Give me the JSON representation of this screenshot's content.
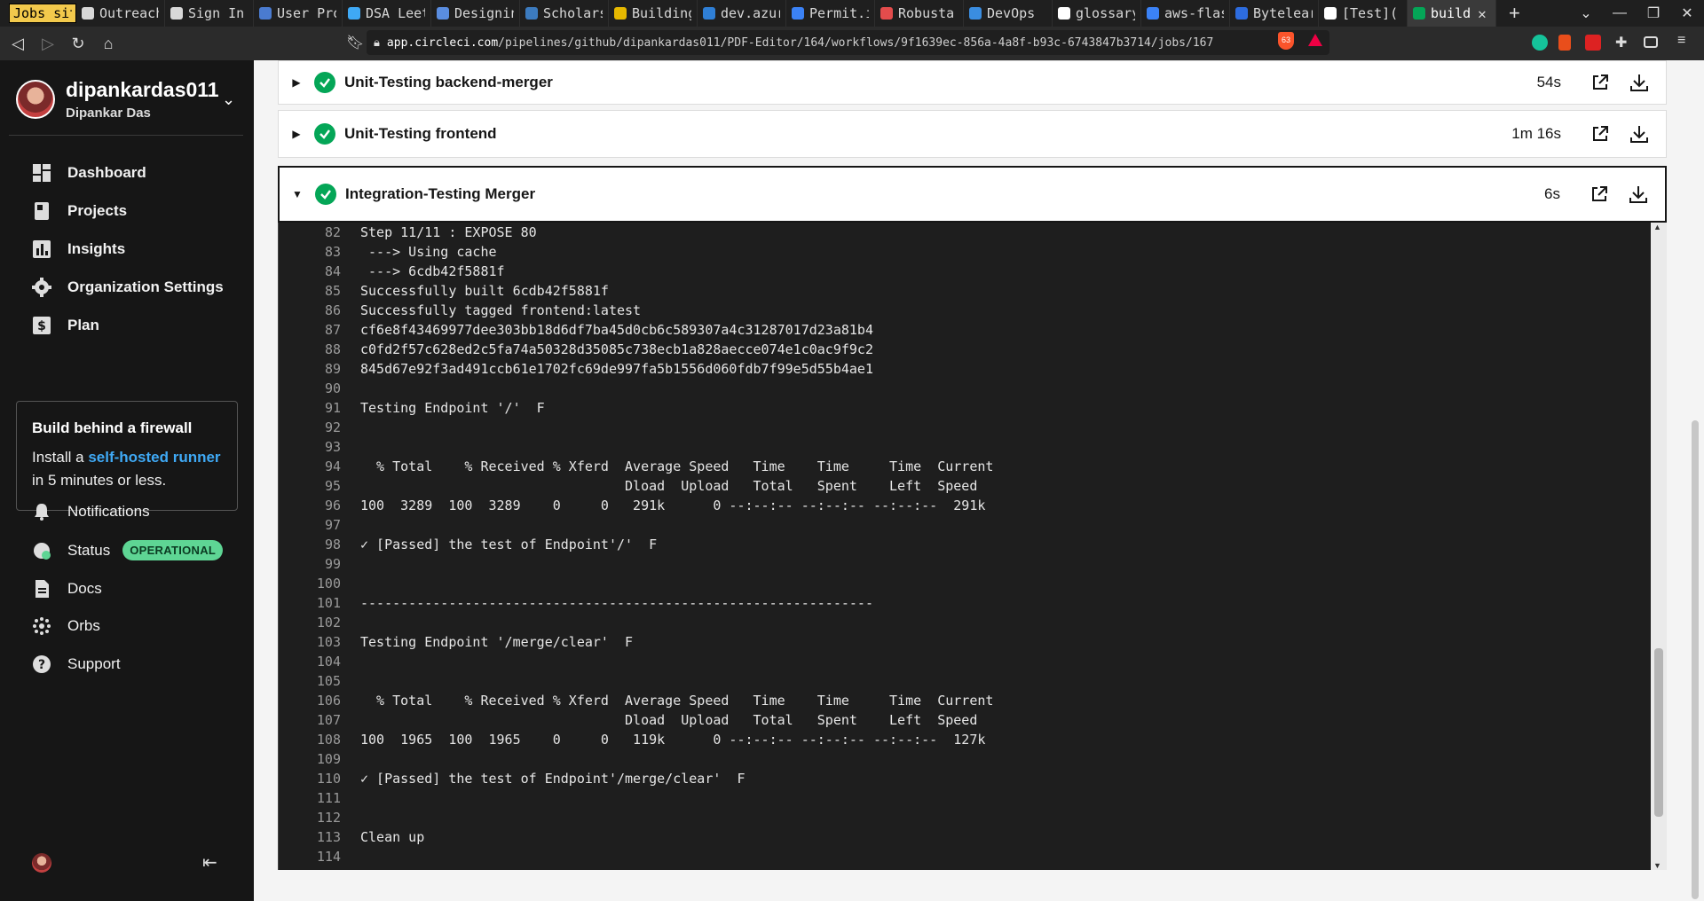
{
  "browser": {
    "tabs": [
      {
        "label": "Jobs sites",
        "color": "#f2c94c",
        "style": "highlight"
      },
      {
        "label": "Outreach",
        "color": "#d8d8d8"
      },
      {
        "label": "Sign In",
        "color": "#d8d8d8"
      },
      {
        "label": "User Pro",
        "color": "#4a7bd0"
      },
      {
        "label": "DSA Leet",
        "color": "#3fa9f5"
      },
      {
        "label": "Designin",
        "color": "#5a8de0"
      },
      {
        "label": "Scholars",
        "color": "#3c7bbf"
      },
      {
        "label": "Building",
        "color": "#e6b800"
      },
      {
        "label": "dev.azur",
        "color": "#2f7fd6"
      },
      {
        "label": "Permit.i",
        "color": "#3b82f6"
      },
      {
        "label": "Robusta",
        "color": "#e34c4c"
      },
      {
        "label": "DevOps",
        "color": "#3a8de0"
      },
      {
        "label": "glossary",
        "color": "#ffffff"
      },
      {
        "label": "aws-flas",
        "color": "#3b82f6"
      },
      {
        "label": "Bytelear",
        "color": "#2d6cdf"
      },
      {
        "label": "[Test](",
        "color": "#ffffff"
      },
      {
        "label": "build",
        "color": "#04a657",
        "style": "active"
      }
    ],
    "new_tab": "+",
    "url_host": "app.circleci.com",
    "url_path": "/pipelines/github/dipankardas011/PDF-Editor/164/workflows/9f1639ec-856a-4a8f-b93c-6743847b3714/jobs/167",
    "shield_count": "63"
  },
  "sidebar": {
    "username": "dipankardas011",
    "fullname": "Dipankar Das",
    "nav": [
      {
        "label": "Dashboard",
        "icon": "dashboard-icon"
      },
      {
        "label": "Projects",
        "icon": "projects-icon"
      },
      {
        "label": "Insights",
        "icon": "insights-icon"
      },
      {
        "label": "Organization Settings",
        "icon": "gear-icon"
      },
      {
        "label": "Plan",
        "icon": "plan-icon"
      }
    ],
    "firewall": {
      "title": "Build behind a firewall",
      "body_pre": "Install a ",
      "link": "self-hosted runner",
      "body_post": "in 5 minutes or less."
    },
    "bottom_nav": [
      {
        "label": "Notifications",
        "icon": "bell-icon"
      },
      {
        "label": "Status",
        "icon": "status-icon",
        "badge": "OPERATIONAL"
      },
      {
        "label": "Docs",
        "icon": "docs-icon"
      },
      {
        "label": "Orbs",
        "icon": "orbs-icon"
      },
      {
        "label": "Support",
        "icon": "help-icon"
      }
    ]
  },
  "jobs": [
    {
      "name": "Unit-Testing backend-merger",
      "duration": "54s",
      "expanded": false
    },
    {
      "name": "Unit-Testing frontend",
      "duration": "1m 16s",
      "expanded": false
    },
    {
      "name": "Integration-Testing Merger",
      "duration": "6s",
      "expanded": true
    }
  ],
  "console": [
    {
      "n": "82",
      "t": "Step 11/11 : EXPOSE 80"
    },
    {
      "n": "83",
      "t": " ---> Using cache"
    },
    {
      "n": "84",
      "t": " ---> 6cdb42f5881f"
    },
    {
      "n": "85",
      "t": "Successfully built 6cdb42f5881f"
    },
    {
      "n": "86",
      "t": "Successfully tagged frontend:latest"
    },
    {
      "n": "87",
      "t": "cf6e8f43469977dee303bb18d6df7ba45d0cb6c589307a4c31287017d23a81b4"
    },
    {
      "n": "88",
      "t": "c0fd2f57c628ed2c5fa74a50328d35085c738ecb1a828aecce074e1c0ac9f9c2"
    },
    {
      "n": "89",
      "t": "845d67e92f3ad491ccb61e1702fc69de997fa5b1556d060fdb7f99e5d55b4ae1"
    },
    {
      "n": "90",
      "t": ""
    },
    {
      "n": "91",
      "t": "Testing Endpoint '/'  F"
    },
    {
      "n": "92",
      "t": ""
    },
    {
      "n": "93",
      "t": ""
    },
    {
      "n": "94",
      "t": "  % Total    % Received % Xferd  Average Speed   Time    Time     Time  Current"
    },
    {
      "n": "95",
      "t": "                                 Dload  Upload   Total   Spent    Left  Speed"
    },
    {
      "n": "96",
      "t": "100  3289  100  3289    0     0   291k      0 --:--:-- --:--:-- --:--:--  291k"
    },
    {
      "n": "97",
      "t": ""
    },
    {
      "n": "98",
      "t": "✓ [Passed] the test of Endpoint'/'  F"
    },
    {
      "n": "99",
      "t": ""
    },
    {
      "n": "100",
      "t": ""
    },
    {
      "n": "101",
      "t": "----------------------------------------------------------------"
    },
    {
      "n": "102",
      "t": ""
    },
    {
      "n": "103",
      "t": "Testing Endpoint '/merge/clear'  F"
    },
    {
      "n": "104",
      "t": ""
    },
    {
      "n": "105",
      "t": ""
    },
    {
      "n": "106",
      "t": "  % Total    % Received % Xferd  Average Speed   Time    Time     Time  Current"
    },
    {
      "n": "107",
      "t": "                                 Dload  Upload   Total   Spent    Left  Speed"
    },
    {
      "n": "108",
      "t": "100  1965  100  1965    0     0   119k      0 --:--:-- --:--:-- --:--:--  127k"
    },
    {
      "n": "109",
      "t": ""
    },
    {
      "n": "110",
      "t": "✓ [Passed] the test of Endpoint'/merge/clear'  F"
    },
    {
      "n": "111",
      "t": ""
    },
    {
      "n": "112",
      "t": ""
    },
    {
      "n": "113",
      "t": "Clean up"
    },
    {
      "n": "114",
      "t": ""
    }
  ],
  "colors": {
    "success": "#04a657",
    "badge": "#5ed594",
    "link": "#3fa9f5"
  }
}
